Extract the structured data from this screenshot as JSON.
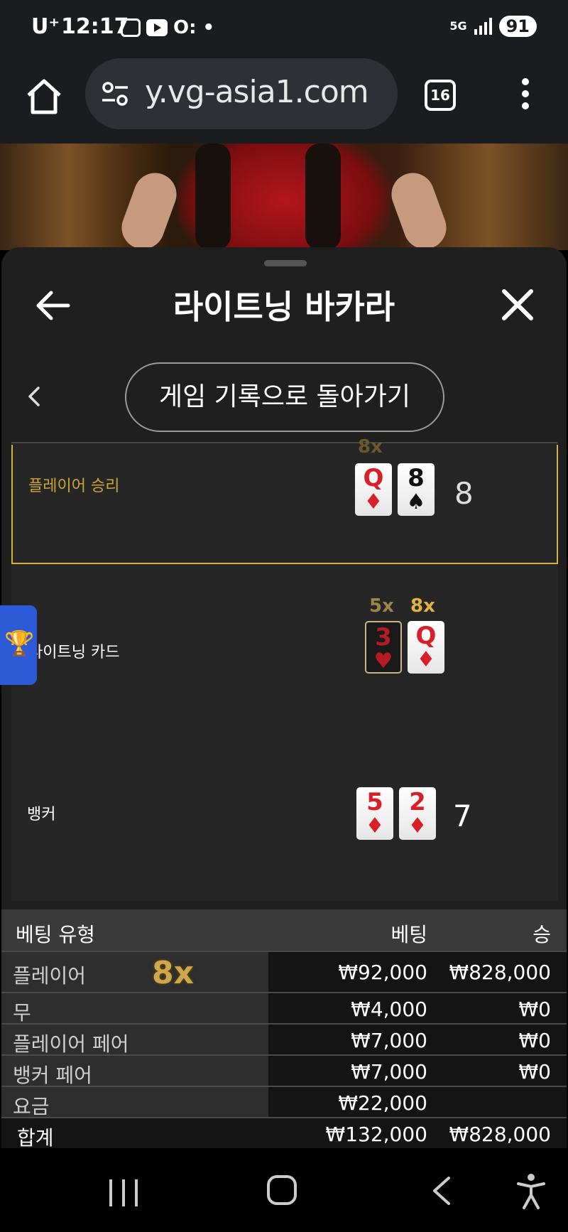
{
  "status_bar": {
    "carrier": "U⁺",
    "time": "12:17",
    "network": "5G",
    "battery": "91"
  },
  "browser": {
    "url": "y.vg-asia1.com",
    "tab_count": "16"
  },
  "panel": {
    "title": "라이트닝 바카라",
    "back_to_history": "게임 기록으로 돌아가기"
  },
  "rounds": {
    "player": {
      "label": "플레이어 승리",
      "ghost_multiplier": "8x",
      "cards": [
        {
          "rank": "Q",
          "suit": "♦",
          "color": "red"
        },
        {
          "rank": "8",
          "suit": "♠",
          "color": "black"
        }
      ],
      "total": "8"
    },
    "lightning": {
      "label": "라이트닝 카드",
      "multipliers": [
        "5x",
        "8x"
      ],
      "cards": [
        {
          "rank": "3",
          "suit": "♥",
          "color": "dark"
        },
        {
          "rank": "Q",
          "suit": "♦",
          "color": "red"
        }
      ]
    },
    "banker": {
      "label": "뱅커",
      "cards": [
        {
          "rank": "5",
          "suit": "♦",
          "color": "red"
        },
        {
          "rank": "2",
          "suit": "♦",
          "color": "red"
        }
      ],
      "total": "7"
    }
  },
  "bets": {
    "headers": {
      "type": "베팅 유형",
      "bet": "베팅",
      "win": "승"
    },
    "rows": [
      {
        "name": "플레이어",
        "multiplier": "8x",
        "bet": "₩92,000",
        "win": "₩828,000"
      },
      {
        "name": "무",
        "bet": "₩4,000",
        "win": "₩0"
      },
      {
        "name": "플레이어 페어",
        "bet": "₩7,000",
        "win": "₩0"
      },
      {
        "name": "뱅커 페어",
        "bet": "₩7,000",
        "win": "₩0"
      },
      {
        "name": "요금",
        "bet": "₩22,000",
        "win": ""
      }
    ],
    "total": {
      "name": "합계",
      "bet": "₩132,000",
      "win": "₩828,000"
    }
  },
  "colors": {
    "win_border": "#d4b23a",
    "multiplier_gold": "#e3b23c",
    "card_red": "#d8202a",
    "trophy_tab": "#2d5bd8"
  }
}
